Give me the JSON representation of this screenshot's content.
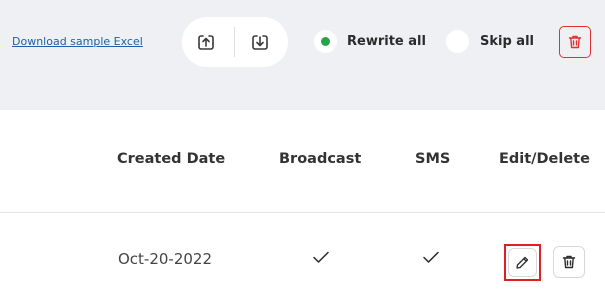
{
  "toolbar": {
    "download_sample_label": "Download sample Excel",
    "upload_icon": "upload-icon",
    "download_icon": "download-icon",
    "options": [
      {
        "label": "Rewrite all",
        "selected": true
      },
      {
        "label": "Skip all",
        "selected": false
      }
    ],
    "delete_all_icon": "trash-icon"
  },
  "table": {
    "headers": [
      "Created Date",
      "Broadcast",
      "SMS",
      "Edit/Delete"
    ],
    "rows": [
      {
        "created_date": "Oct-20-2022",
        "broadcast": true,
        "sms": true
      }
    ]
  },
  "colors": {
    "accent_green": "#22a447",
    "danger_red": "#e03131",
    "topbar_bg": "#eef0f4",
    "link_blue": "#1f5fa8"
  }
}
